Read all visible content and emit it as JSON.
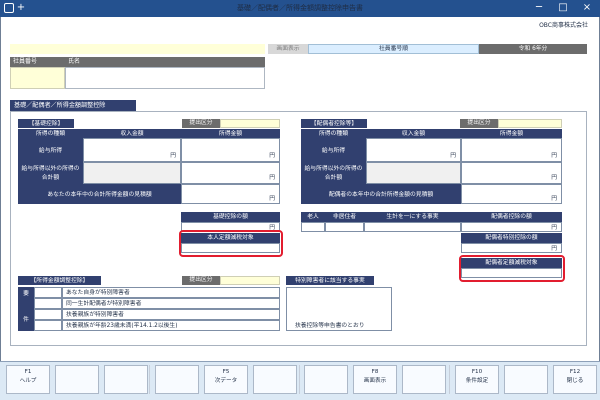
{
  "window": {
    "title": "基礎／配偶者／所得金額調整控除申告書",
    "company": "OBC商事株式会社",
    "minimize": "─",
    "maximize": "□",
    "close": "×"
  },
  "header": {
    "status": "画面表示",
    "employee_order": "社員番号順",
    "year": "令和 6年分",
    "employee_number_label": "社員番号",
    "name_label": "氏名"
  },
  "sections": {
    "main_tab": "基礎／配偶者／所得金額調整控除",
    "basic_title": "【基礎控除】",
    "spouse_title": "【配偶者控除等】",
    "adjust_title": "【所得金額調整控除】",
    "submit_label": "提出区分"
  },
  "basic": {
    "col_type": "所得の種類",
    "col_income": "収入金額",
    "col_amount": "所得金額",
    "row_salary": "給与所得",
    "row_other": "給与所得以外の所得の合計額",
    "row_total": "あなたの本年中の合計所得金額の見積額",
    "deduction": "基礎控除の額",
    "target": "本人定額減税対象",
    "yen": "円"
  },
  "spouse": {
    "col_type": "所得の種類",
    "col_income": "収入金額",
    "col_amount": "所得金額",
    "row_salary": "給与所得",
    "row_other": "給与所得以外の所得の合計額",
    "row_total": "配偶者の本年中の合計所得金額の見積額",
    "elderly": "老人",
    "nonresident": "非居住者",
    "livelihood": "生計を一にする事実",
    "deduction": "配偶者控除の額",
    "special": "配偶者特別控除の額",
    "target": "配偶者定額減税対象",
    "yen": "円"
  },
  "adjust": {
    "requirement_top": "要",
    "requirement_bottom": "件",
    "row1": "あなた自身が特別障害者",
    "row2": "同一生計配偶者が特別障害者",
    "row3": "扶養親族が特別障害者",
    "row4": "扶養親族が年齢23歳未満(平14.1.2以後生)",
    "fact_title": "特別障害者に該当する事実",
    "fact_note": "扶養控除等申告書のとおり"
  },
  "function_keys": [
    {
      "key": "F1",
      "label": "ヘルプ"
    },
    {
      "key": "",
      "label": ""
    },
    {
      "key": "",
      "label": ""
    },
    {
      "key": "",
      "label": ""
    },
    {
      "key": "F5",
      "label": "次データ"
    },
    {
      "key": "",
      "label": ""
    },
    {
      "key": "",
      "label": ""
    },
    {
      "key": "F8",
      "label": "画面表示"
    },
    {
      "key": "",
      "label": ""
    },
    {
      "key": "F10",
      "label": "条件設定"
    },
    {
      "key": "",
      "label": ""
    },
    {
      "key": "F12",
      "label": "閉じる"
    }
  ],
  "colors": {
    "title": "#24518f",
    "navy": "#31406f",
    "highlight": "#e21d2f",
    "yellow": "#ffffd8",
    "cyan": "#d9ffff"
  }
}
